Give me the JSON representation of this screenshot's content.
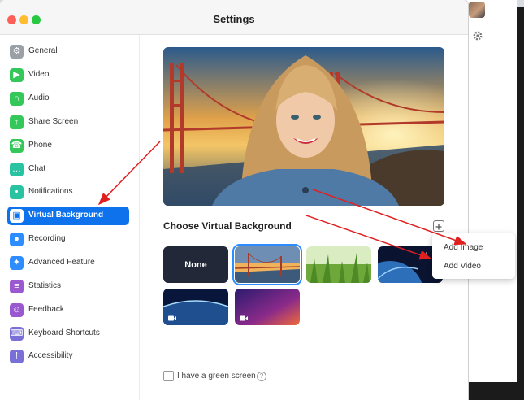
{
  "window": {
    "title": "Settings"
  },
  "sidebar": {
    "items": [
      {
        "label": "General",
        "icon": "gear-icon",
        "color": "#9aa0a6",
        "selected": false
      },
      {
        "label": "Video",
        "icon": "video-camera-icon",
        "color": "#34c759",
        "selected": false
      },
      {
        "label": "Audio",
        "icon": "headphones-icon",
        "color": "#34c759",
        "selected": false
      },
      {
        "label": "Share Screen",
        "icon": "share-screen-icon",
        "color": "#34c759",
        "selected": false
      },
      {
        "label": "Phone",
        "icon": "phone-icon",
        "color": "#34c759",
        "selected": false
      },
      {
        "label": "Chat",
        "icon": "chat-bubble-icon",
        "color": "#2ac3a2",
        "selected": false
      },
      {
        "label": "Notifications",
        "icon": "bell-icon",
        "color": "#2ac3a2",
        "selected": false
      },
      {
        "label": "Virtual Background",
        "icon": "person-card-icon",
        "color": "#0e72ed",
        "selected": true
      },
      {
        "label": "Recording",
        "icon": "record-icon",
        "color": "#2d8cff",
        "selected": false
      },
      {
        "label": "Advanced Feature",
        "icon": "sparkle-icon",
        "color": "#2d8cff",
        "selected": false
      },
      {
        "label": "Statistics",
        "icon": "bar-chart-icon",
        "color": "#9b59d0",
        "selected": false
      },
      {
        "label": "Feedback",
        "icon": "smiley-icon",
        "color": "#9b59d0",
        "selected": false
      },
      {
        "label": "Keyboard Shortcuts",
        "icon": "keyboard-icon",
        "color": "#7a6fd6",
        "selected": false
      },
      {
        "label": "Accessibility",
        "icon": "accessibility-icon",
        "color": "#7a6fd6",
        "selected": false
      }
    ]
  },
  "main": {
    "section_title": "Choose Virtual Background",
    "thumbnails": [
      {
        "label": "None",
        "kind": "none",
        "selected": false,
        "video": false
      },
      {
        "label": "",
        "kind": "bridge",
        "selected": true,
        "video": false
      },
      {
        "label": "",
        "kind": "grass",
        "selected": false,
        "video": false
      },
      {
        "label": "",
        "kind": "earth",
        "selected": false,
        "video": false
      },
      {
        "label": "",
        "kind": "earth-horizon",
        "selected": false,
        "video": true
      },
      {
        "label": "",
        "kind": "aurora",
        "selected": false,
        "video": true
      }
    ],
    "green_screen": {
      "label": "I have a green screen",
      "checked": false
    }
  },
  "add_menu": {
    "items": [
      "Add Image",
      "Add Video"
    ]
  },
  "colors": {
    "accent": "#0e72ed",
    "annotation": "#e02020"
  }
}
